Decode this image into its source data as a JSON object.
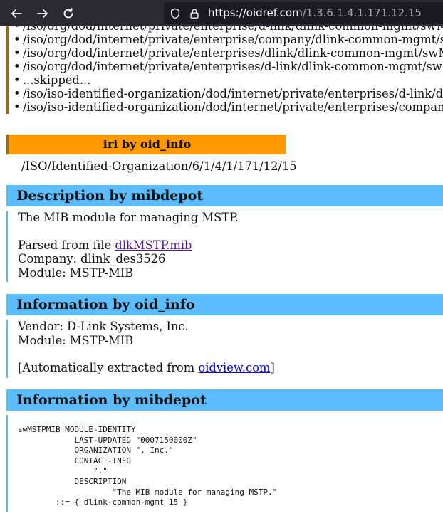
{
  "browser": {
    "url_host": "https://oidref.com",
    "url_path": "/1.3.6.1.4.1.171.12.15"
  },
  "oid_paths": [
    "/iso/org/dod/internet/private/enterprise/d-link/dlink-common-mgmt/swMSTPMIB",
    "/iso/org/dod/internet/private/enterprise/company/dlink-common-mgmt/swMSTPMIB",
    "/iso/org/dod/internet/private/enterprises/dlink/dlink-common-mgmt/swMSTPMIB",
    "/iso/org/dod/internet/private/enterprises/d-link/dlink-common-mgmt/swMSTPMIB",
    "...skipped...",
    "/iso/iso-identified-organization/dod/internet/private/enterprises/d-link/dlink-common-mgmt",
    "/iso/iso-identified-organization/dod/internet/private/enterprises/company/dlink-common-mgmt"
  ],
  "iri": {
    "heading": "iri by oid_info",
    "value": "/ISO/Identified-Organization/6/1/4/1/171/12/15"
  },
  "description_mibdepot": {
    "heading": "Description by mibdepot",
    "text": "The MIB module for managing MSTP.",
    "parsed_prefix": "Parsed from file ",
    "parsed_file": "dlkMSTP.mib",
    "company": "Company: dlink_des3526",
    "module": "Module: MSTP-MIB"
  },
  "info_oid_info": {
    "heading": "Information by oid_info",
    "vendor": "Vendor: D-Link Systems, Inc.",
    "module": "Module: MSTP-MIB",
    "extracted_prefix": "[Automatically extracted from ",
    "extracted_link": "oidview.com",
    "extracted_suffix": "]"
  },
  "info_mibdepot": {
    "heading": "Information by mibdepot",
    "code": "swMSTPMIB MODULE-IDENTITY\n            LAST-UPDATED \"0007150000Z\"\n            ORGANIZATION \", Inc.\"\n            CONTACT-INFO\n                \".\"\n            DESCRIPTION\n                    \"The MIB module for managing MSTP.\"\n        ::= { dlink-common-mgmt 15 }"
  }
}
